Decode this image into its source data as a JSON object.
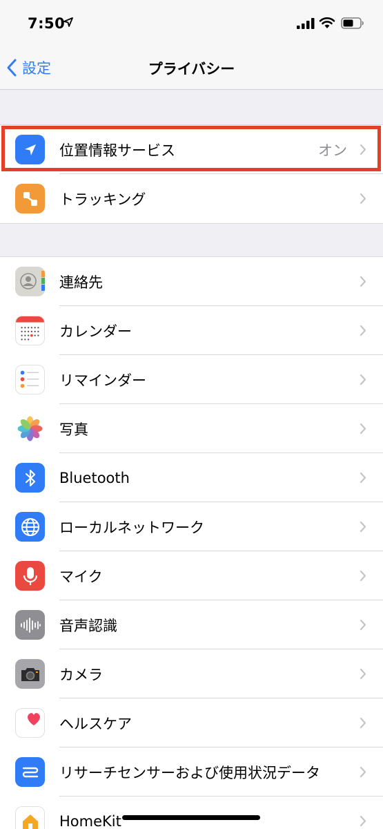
{
  "status_bar": {
    "time": "7:50"
  },
  "nav": {
    "back_label": "設定",
    "title": "プライバシー"
  },
  "group1": [
    {
      "label": "位置情報サービス",
      "value": "オン"
    },
    {
      "label": "トラッキング"
    }
  ],
  "group2": [
    {
      "label": "連絡先"
    },
    {
      "label": "カレンダー"
    },
    {
      "label": "リマインダー"
    },
    {
      "label": "写真"
    },
    {
      "label": "Bluetooth"
    },
    {
      "label": "ローカルネットワーク"
    },
    {
      "label": "マイク"
    },
    {
      "label": "音声認識"
    },
    {
      "label": "カメラ"
    },
    {
      "label": "ヘルスケア"
    },
    {
      "label": "リサーチセンサーおよび使用状況データ"
    },
    {
      "label": "HomeKit"
    }
  ],
  "colors": {
    "accent": "#2f7cf6",
    "highlight": "#e34027",
    "location_icon": "#2f7cf6",
    "tracking_icon": "#f29a38",
    "bluetooth_icon": "#2f7cf6",
    "network_icon": "#2f7cf6",
    "mic_icon": "#e9493e",
    "speech_icon": "#8e8e93",
    "camera_icon": "#8e8e93",
    "research_icon": "#2f7cf6"
  }
}
